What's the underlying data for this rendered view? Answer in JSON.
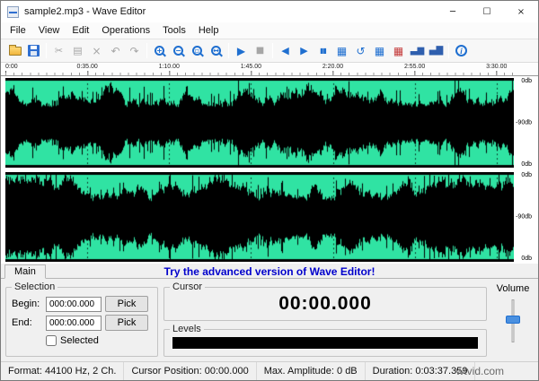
{
  "window": {
    "title": "sample2.mp3 - Wave Editor",
    "minimize": "─",
    "maximize": "☐",
    "close": "×"
  },
  "menu": {
    "items": [
      "File",
      "View",
      "Edit",
      "Operations",
      "Tools",
      "Help"
    ]
  },
  "toolbar": {
    "icons": {
      "cut": "✂",
      "copy": "▤",
      "delete": "×",
      "undo": "↶",
      "redo": "↷",
      "zoom_in": "+",
      "zoom_out": "−",
      "zoom_selection": "▫",
      "zoom_full": "↔",
      "play": "▶",
      "stop": "■",
      "skip_start": "◀",
      "play_selection": "▶",
      "pause": "▮▮",
      "grid": "▦",
      "revert_zoom": "↺",
      "grid2": "▦",
      "markers": "▦",
      "chart1": "▃▆",
      "chart2": "▄▇",
      "info": "i"
    }
  },
  "ruler": {
    "ticks": [
      "0:00",
      "0:35.00",
      "1:10.00",
      "1:45.00",
      "2:20.00",
      "2:55.00",
      "3:30.00"
    ]
  },
  "waveform": {
    "bg_color": "#30e3a3",
    "wave_color": "#000000",
    "grid_interval_s": 35,
    "duration_s": 217.359,
    "db_labels": [
      "0db",
      "-90db",
      "0db"
    ]
  },
  "bottom": {
    "tab": "Main",
    "promo": "Try the advanced version of Wave Editor!",
    "selection": {
      "title": "Selection",
      "begin_label": "Begin:",
      "begin_value": "000:00.000",
      "end_label": "End:",
      "end_value": "000:00.000",
      "pick": "Pick",
      "selected": "Selected"
    },
    "cursor": {
      "title": "Cursor",
      "value": "00:00.000"
    },
    "levels": {
      "title": "Levels"
    },
    "volume": {
      "title": "Volume"
    }
  },
  "status": {
    "format": "Format: 44100 Hz, 2 Ch.",
    "cursor": "Cursor Position: 00:00.000",
    "amplitude": "Max. Amplitude: 0 dB",
    "duration": "Duration: 0:03:37.359"
  },
  "watermark": "wtvid.com"
}
